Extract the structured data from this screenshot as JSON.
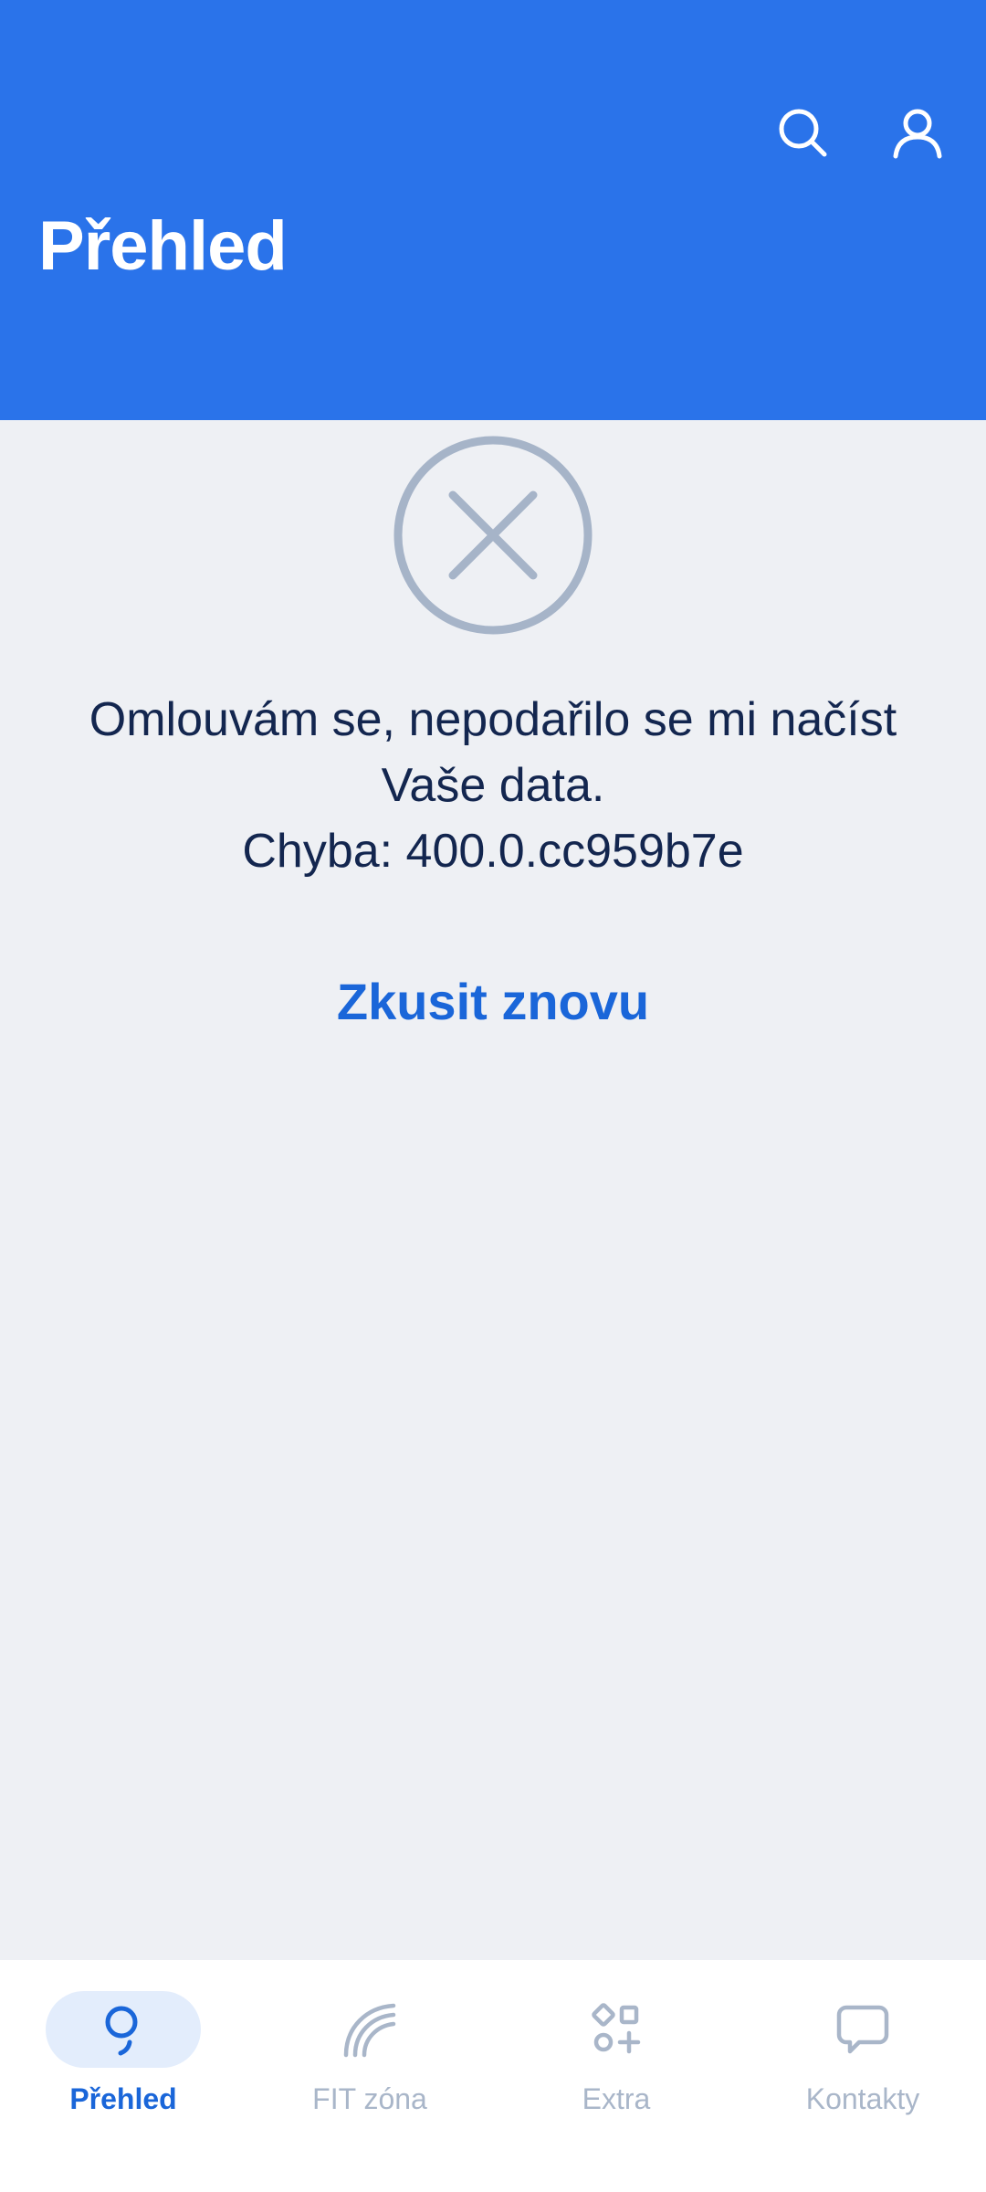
{
  "header": {
    "title": "Přehled",
    "background_color": "#2a73ea",
    "actions": [
      {
        "icon": "search-icon"
      },
      {
        "icon": "user-icon"
      }
    ]
  },
  "error": {
    "icon": "close-circle-icon",
    "message_line1": "Omlouvám se, nepodařilo se mi načíst",
    "message_line2": "Vaše data.",
    "message_line3": "Chyba: 400.0.cc959b7e",
    "retry_label": "Zkusit znovu"
  },
  "bottom_nav": {
    "active_color": "#1a66d9",
    "inactive_color": "#a9b6c9",
    "items": [
      {
        "label": "Přehled",
        "icon": "overview-icon",
        "active": true
      },
      {
        "label": "FIT zóna",
        "icon": "signal-arcs-icon",
        "active": false
      },
      {
        "label": "Extra",
        "icon": "apps-grid-icon",
        "active": false
      },
      {
        "label": "Kontakty",
        "icon": "chat-bubble-icon",
        "active": false
      }
    ]
  }
}
